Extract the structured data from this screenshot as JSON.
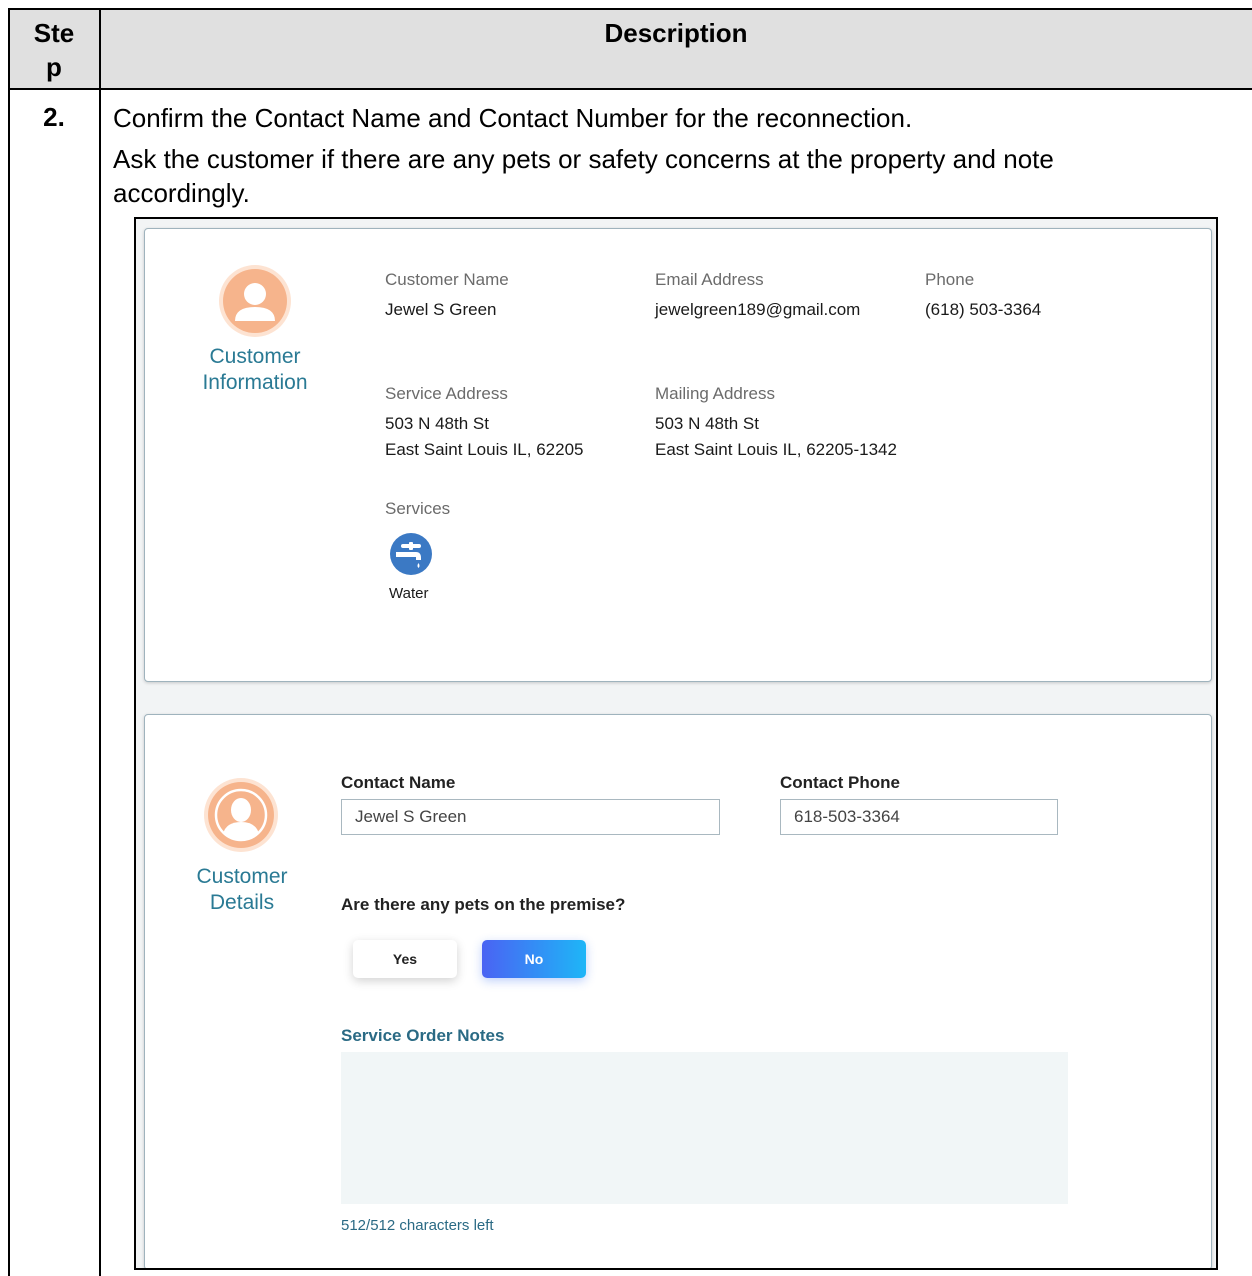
{
  "table": {
    "header_step": [
      "Ste",
      "p"
    ],
    "header_description": "Description",
    "step_number": "2.",
    "instructions": [
      "Confirm the Contact Name and Contact Number for the reconnection.",
      "Ask the customer if there are any pets or safety concerns at the property and note",
      "accordingly."
    ]
  },
  "customer_information": {
    "title": [
      "Customer",
      "Information"
    ],
    "customer_name_label": "Customer Name",
    "customer_name": "Jewel S Green",
    "email_label": "Email Address",
    "email": "jewelgreen189@gmail.com",
    "phone_label": "Phone",
    "phone": "(618) 503-3364",
    "service_address_label": "Service Address",
    "service_address": [
      "503 N 48th St",
      "East Saint Louis IL, 62205"
    ],
    "mailing_address_label": "Mailing Address",
    "mailing_address": [
      "503 N 48th St",
      "East Saint Louis IL, 62205-1342"
    ],
    "services_label": "Services",
    "service_name": "Water",
    "service_icon": "water-faucet-icon"
  },
  "customer_details": {
    "title": [
      "Customer",
      "Details"
    ],
    "contact_name_label": "Contact Name",
    "contact_name_value": "Jewel S Green",
    "contact_phone_label": "Contact Phone",
    "contact_phone_value": "618-503-3364",
    "pets_question": "Are there any pets on the premise?",
    "yes_label": "Yes",
    "no_label": "No",
    "selected_option": "No",
    "notes_label": "Service Order Notes",
    "notes_value": "",
    "characters_left": "512/512 characters left"
  },
  "colors": {
    "accent_teal": "#2a7a94",
    "avatar_orange": "#f6b48c",
    "water_icon_blue": "#3b79c4",
    "no_button_gradient": [
      "#4a63f3",
      "#1eb6f7"
    ],
    "header_gray": "#e0e0e0"
  }
}
